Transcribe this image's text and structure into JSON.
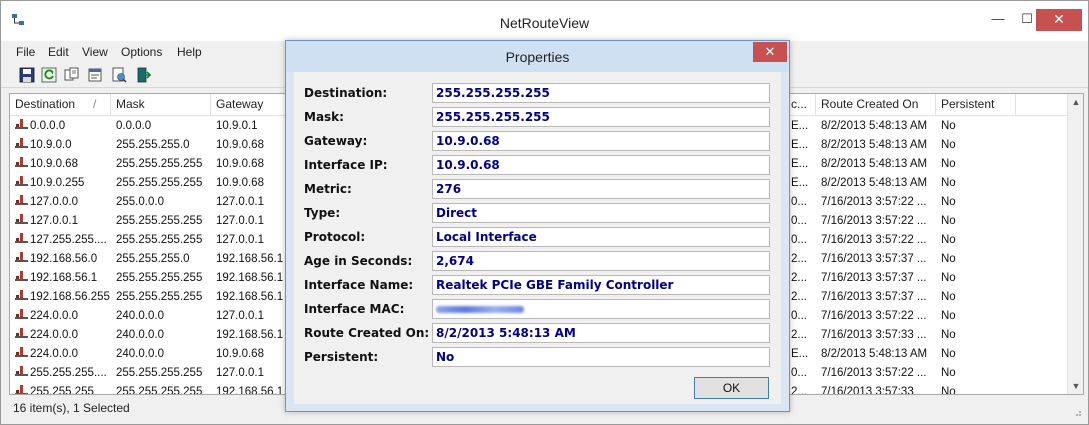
{
  "app": {
    "title": "NetRouteView"
  },
  "menu": [
    "File",
    "Edit",
    "View",
    "Options",
    "Help"
  ],
  "toolbar": {
    "icons": [
      "save-icon",
      "refresh-icon",
      "copy-icon",
      "properties-icon",
      "html-report-icon",
      "exit-icon"
    ]
  },
  "listview": {
    "columns": [
      {
        "label": "Destination",
        "sort": "/"
      },
      {
        "label": "Mask"
      },
      {
        "label": "Gateway"
      },
      {
        "label": "c..."
      },
      {
        "label": "Route Created On"
      },
      {
        "label": "Persistent"
      }
    ],
    "rows": [
      {
        "destination": "0.0.0.0",
        "mask": "0.0.0.0",
        "gateway": "10.9.0.1",
        "col4": "E...",
        "created": "8/2/2013 5:48:13 AM",
        "persistent": "No"
      },
      {
        "destination": "10.9.0.0",
        "mask": "255.255.255.0",
        "gateway": "10.9.0.68",
        "col4": "E...",
        "created": "8/2/2013 5:48:13 AM",
        "persistent": "No"
      },
      {
        "destination": "10.9.0.68",
        "mask": "255.255.255.255",
        "gateway": "10.9.0.68",
        "col4": "E...",
        "created": "8/2/2013 5:48:13 AM",
        "persistent": "No"
      },
      {
        "destination": "10.9.0.255",
        "mask": "255.255.255.255",
        "gateway": "10.9.0.68",
        "col4": "E...",
        "created": "8/2/2013 5:48:13 AM",
        "persistent": "No"
      },
      {
        "destination": "127.0.0.0",
        "mask": "255.0.0.0",
        "gateway": "127.0.0.1",
        "col4": "0...",
        "created": "7/16/2013 3:57:22 ...",
        "persistent": "No"
      },
      {
        "destination": "127.0.0.1",
        "mask": "255.255.255.255",
        "gateway": "127.0.0.1",
        "col4": "0...",
        "created": "7/16/2013 3:57:22 ...",
        "persistent": "No"
      },
      {
        "destination": "127.255.255....",
        "mask": "255.255.255.255",
        "gateway": "127.0.0.1",
        "col4": "0...",
        "created": "7/16/2013 3:57:22 ...",
        "persistent": "No"
      },
      {
        "destination": "192.168.56.0",
        "mask": "255.255.255.0",
        "gateway": "192.168.56.1",
        "col4": "2...",
        "created": "7/16/2013 3:57:37 ...",
        "persistent": "No"
      },
      {
        "destination": "192.168.56.1",
        "mask": "255.255.255.255",
        "gateway": "192.168.56.1",
        "col4": "2...",
        "created": "7/16/2013 3:57:37 ...",
        "persistent": "No"
      },
      {
        "destination": "192.168.56.255",
        "mask": "255.255.255.255",
        "gateway": "192.168.56.1",
        "col4": "2...",
        "created": "7/16/2013 3:57:37 ...",
        "persistent": "No"
      },
      {
        "destination": "224.0.0.0",
        "mask": "240.0.0.0",
        "gateway": "127.0.0.1",
        "col4": "0...",
        "created": "7/16/2013 3:57:22 ...",
        "persistent": "No"
      },
      {
        "destination": "224.0.0.0",
        "mask": "240.0.0.0",
        "gateway": "192.168.56.1",
        "col4": "2...",
        "created": "7/16/2013 3:57:33 ...",
        "persistent": "No"
      },
      {
        "destination": "224.0.0.0",
        "mask": "240.0.0.0",
        "gateway": "10.9.0.68",
        "col4": "E...",
        "created": "8/2/2013 5:48:13 AM",
        "persistent": "No"
      },
      {
        "destination": "255.255.255....",
        "mask": "255.255.255.255",
        "gateway": "127.0.0.1",
        "col4": "0...",
        "created": "7/16/2013 3:57:22 ...",
        "persistent": "No"
      },
      {
        "destination": "255.255.255",
        "mask": "255.255.255.255",
        "gateway": "192.168.56.1",
        "col4": "2...",
        "created": "7/16/2013 3:57:33",
        "persistent": "No"
      }
    ]
  },
  "status": {
    "text": "16 item(s), 1 Selected"
  },
  "dialog": {
    "title": "Properties",
    "fields": [
      {
        "label": "Destination:",
        "value": "255.255.255.255"
      },
      {
        "label": "Mask:",
        "value": "255.255.255.255"
      },
      {
        "label": "Gateway:",
        "value": "10.9.0.68"
      },
      {
        "label": "Interface IP:",
        "value": "10.9.0.68"
      },
      {
        "label": "Metric:",
        "value": "276"
      },
      {
        "label": "Type:",
        "value": "Direct"
      },
      {
        "label": "Protocol:",
        "value": "Local Interface"
      },
      {
        "label": "Age in Seconds:",
        "value": "2,674"
      },
      {
        "label": "Interface Name:",
        "value": "Realtek PCIe GBE Family Controller"
      },
      {
        "label": "Interface MAC:",
        "value": ""
      },
      {
        "label": "Route Created On:",
        "value": "8/2/2013 5:48:13 AM"
      },
      {
        "label": "Persistent:",
        "value": "No"
      }
    ],
    "ok_label": "OK"
  },
  "colors": {
    "value_text": "#00008b",
    "close_button": "#c75050",
    "dialog_frame": "#6c92c7"
  }
}
